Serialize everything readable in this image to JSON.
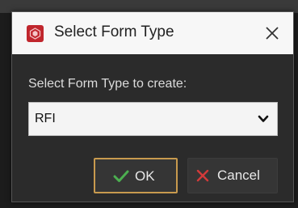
{
  "dialog": {
    "title": "Select Form Type",
    "icon": "app-logo-icon",
    "close_icon": "close-icon"
  },
  "form": {
    "prompt": "Select Form Type to create:",
    "selected_value": "RFI",
    "dropdown_icon": "chevron-down-icon"
  },
  "buttons": {
    "ok_label": "OK",
    "ok_icon": "checkmark-icon",
    "cancel_label": "Cancel",
    "cancel_icon": "x-icon"
  },
  "colors": {
    "accent": "#c89a4e",
    "ok_icon": "#4caf50",
    "cancel_icon": "#d23a3a",
    "app_icon": "#c0262d"
  }
}
